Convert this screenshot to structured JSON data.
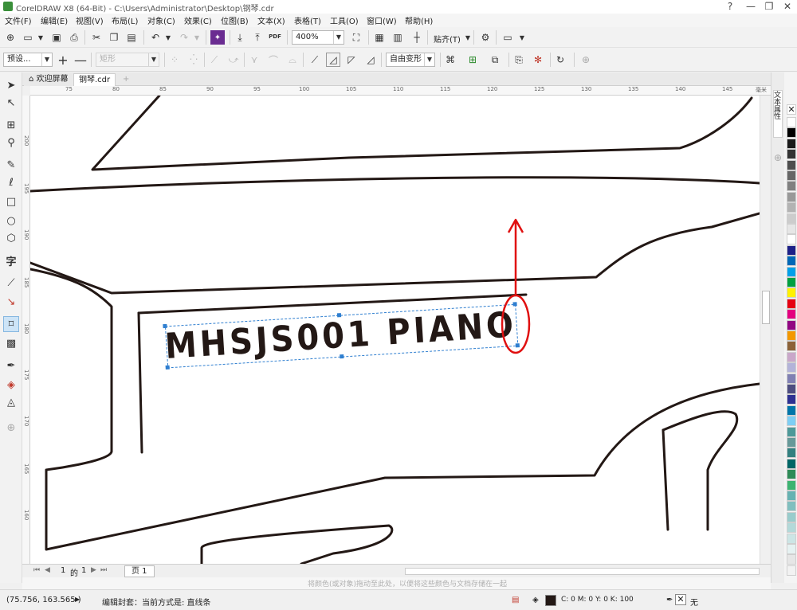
{
  "window": {
    "title": "CorelDRAW X8 (64-Bit) - C:\\Users\\Administrator\\Desktop\\钢琴.cdr",
    "controls": [
      "?",
      "—",
      "❐",
      "✕"
    ]
  },
  "menu": [
    "文件(F)",
    "编辑(E)",
    "视图(V)",
    "布局(L)",
    "对象(C)",
    "效果(C)",
    "位图(B)",
    "文本(X)",
    "表格(T)",
    "工具(O)",
    "窗口(W)",
    "帮助(H)"
  ],
  "standard_toolbar": {
    "zoom": "400%",
    "snap_label": "贴齐(T)",
    "pdf_label": "PDF"
  },
  "property_bar": {
    "preset": "预设...",
    "shape": "矩形",
    "mode": "自由变形"
  },
  "tabs": {
    "welcome": "欢迎屏幕",
    "document": "钢琴.cdr"
  },
  "ruler": {
    "unit": "毫米",
    "top_labels": [
      "75",
      "80",
      "85",
      "90",
      "95",
      "100",
      "105",
      "110",
      "115",
      "120",
      "125",
      "130",
      "135",
      "140",
      "145"
    ],
    "left_labels": [
      "200",
      "195",
      "190",
      "185",
      "180",
      "175",
      "170",
      "165",
      "160"
    ]
  },
  "canvas": {
    "text_object": "MHSJS001 PIANO"
  },
  "pagebar": {
    "page_index": "1",
    "of_label": "的",
    "page_total": "1",
    "page_tab": "页 1",
    "hint": "将颜色(或对象)拖动至此处，以便将这些颜色与文档存储在一起"
  },
  "docker": {
    "label": "文本属性"
  },
  "palette": [
    "#ffffff",
    "#000000",
    "#1a1a1a",
    "#333333",
    "#4d4d4d",
    "#666666",
    "#808080",
    "#999999",
    "#b3b3b3",
    "#cccccc",
    "#e6e6e6",
    "#ffffff",
    "#1d2088",
    "#0068b7",
    "#00a0e9",
    "#00a040",
    "#fff100",
    "#e60012",
    "#e4007f",
    "#920783",
    "#f39800",
    "#8c6239",
    "#c9a7c9",
    "#b3b3d9",
    "#8080b3",
    "#4d4d80",
    "#2e3192",
    "#0075a9",
    "#7ecef4",
    "#4d9999",
    "#669999",
    "#338080",
    "#006666",
    "#2e8b57",
    "#3cb371",
    "#66b2b2",
    "#80bfbf",
    "#99cccc",
    "#b3d9d9",
    "#cce5e5",
    "#e6f2f2",
    "#e6e6e6",
    "#f2f2f2"
  ],
  "status": {
    "coords": "(75.756, 163.565 )",
    "message": "编辑封套：当前方式是: 直线条",
    "fill_info": "C: 0 M: 0 Y: 0 K: 100",
    "outline": "无"
  },
  "colors": {
    "annotation": "#e01010",
    "selection": "#2f7fd0",
    "text_fill": "#231815"
  }
}
